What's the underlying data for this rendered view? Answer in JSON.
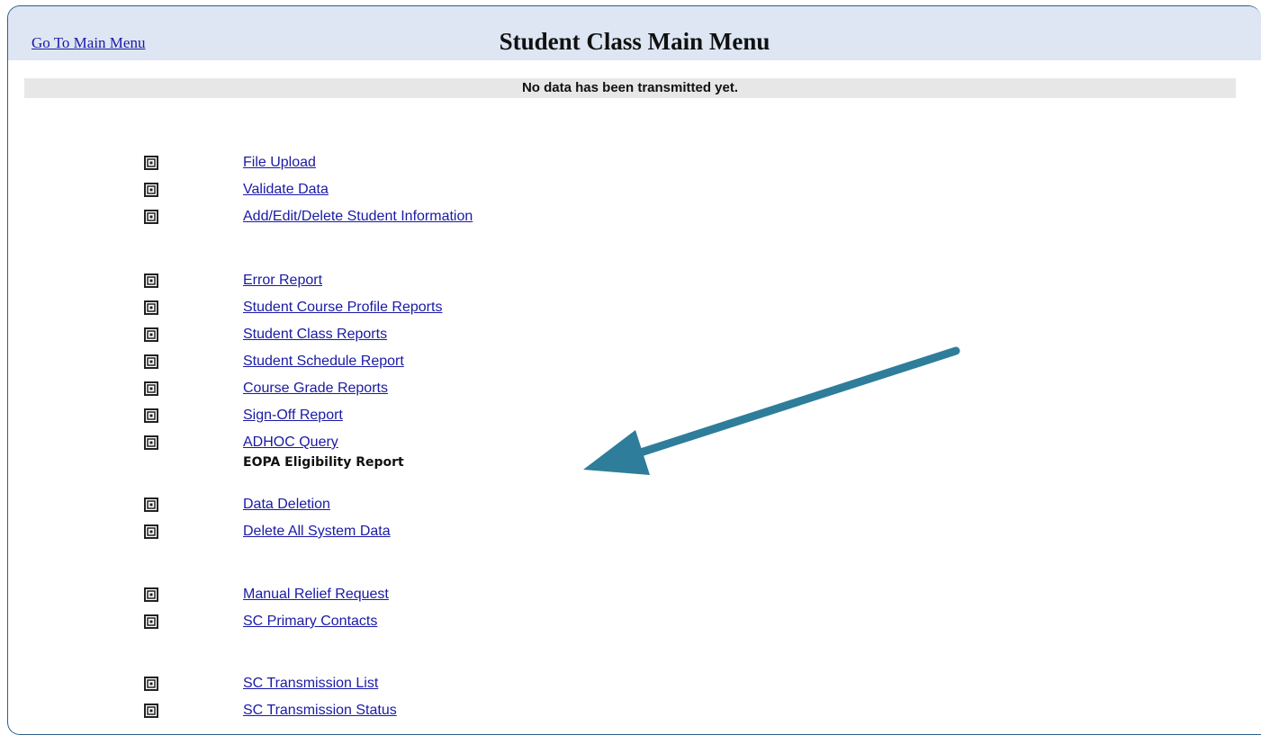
{
  "header": {
    "main_menu_link": "Go To Main Menu",
    "title": "Student Class Main Menu"
  },
  "status_message": "No data has been transmitted yet.",
  "menu": {
    "file_upload": "File Upload",
    "validate_data": "Validate Data",
    "add_edit_delete": "Add/Edit/Delete Student Information",
    "error_report": "Error Report",
    "student_course_profile": "Student Course Profile Reports",
    "student_class_reports": "Student Class Reports",
    "student_schedule_report": "Student Schedule Report",
    "course_grade_reports": "Course Grade Reports",
    "sign_off_report": "Sign-Off Report",
    "adhoc_query": "ADHOC Query",
    "eopa_label": "EOPA Eligibility Report",
    "data_deletion": "Data Deletion",
    "delete_all": "Delete All System Data",
    "manual_relief": "Manual Relief Request",
    "sc_primary_contacts": "SC Primary Contacts",
    "sc_transmission_list": "SC Transmission List",
    "sc_transmission_status": "SC Transmission Status"
  },
  "icon": "menu-bullet-icon",
  "colors": {
    "link": "#1a1aa6",
    "header_bg": "#dde6f2",
    "status_bg": "#e7e7e7",
    "arrow": "#2e7d9a"
  }
}
